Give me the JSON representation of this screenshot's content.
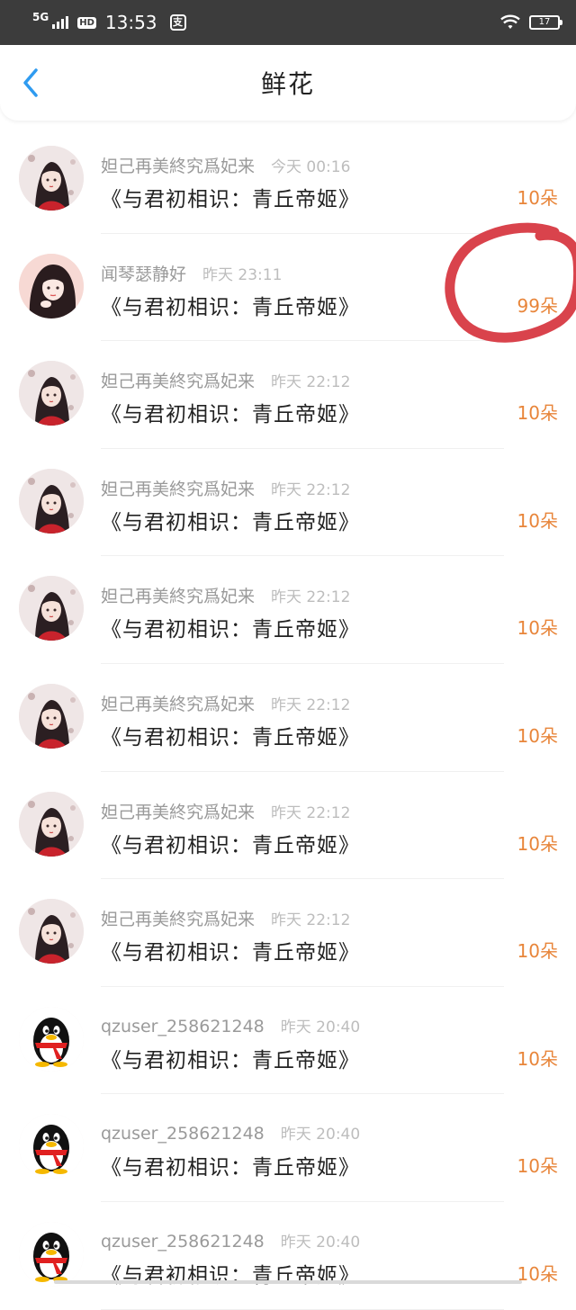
{
  "status": {
    "network": "5G",
    "hd": "HD",
    "time": "13:53",
    "pay_icon": "支",
    "battery": "17"
  },
  "header": {
    "title": "鲜花"
  },
  "rows": [
    {
      "user": "妲己再美終究爲妃来",
      "time": "今天 00:16",
      "book": "《与君初相识：青丘帝姬》",
      "count": "10朵",
      "avatar": "anime-girl"
    },
    {
      "user": "闻琴瑟静好",
      "time": "昨天 23:11",
      "book": "《与君初相识：青丘帝姬》",
      "count": "99朵",
      "avatar": "anime-girl-pink"
    },
    {
      "user": "妲己再美終究爲妃来",
      "time": "昨天 22:12",
      "book": "《与君初相识：青丘帝姬》",
      "count": "10朵",
      "avatar": "anime-girl"
    },
    {
      "user": "妲己再美終究爲妃来",
      "time": "昨天 22:12",
      "book": "《与君初相识：青丘帝姬》",
      "count": "10朵",
      "avatar": "anime-girl"
    },
    {
      "user": "妲己再美終究爲妃来",
      "time": "昨天 22:12",
      "book": "《与君初相识：青丘帝姬》",
      "count": "10朵",
      "avatar": "anime-girl"
    },
    {
      "user": "妲己再美終究爲妃来",
      "time": "昨天 22:12",
      "book": "《与君初相识：青丘帝姬》",
      "count": "10朵",
      "avatar": "anime-girl"
    },
    {
      "user": "妲己再美終究爲妃来",
      "time": "昨天 22:12",
      "book": "《与君初相识：青丘帝姬》",
      "count": "10朵",
      "avatar": "anime-girl"
    },
    {
      "user": "妲己再美終究爲妃来",
      "time": "昨天 22:12",
      "book": "《与君初相识：青丘帝姬》",
      "count": "10朵",
      "avatar": "anime-girl"
    },
    {
      "user": "qzuser_258621248",
      "time": "昨天 20:40",
      "book": "《与君初相识：青丘帝姬》",
      "count": "10朵",
      "avatar": "qq-penguin"
    },
    {
      "user": "qzuser_258621248",
      "time": "昨天 20:40",
      "book": "《与君初相识：青丘帝姬》",
      "count": "10朵",
      "avatar": "qq-penguin"
    },
    {
      "user": "qzuser_258621248",
      "time": "昨天 20:40",
      "book": "《与君初相识：青丘帝姬》",
      "count": "10朵",
      "avatar": "qq-penguin"
    }
  ],
  "colors": {
    "status_bar": "#3c3c3c",
    "back_arrow": "#2f9bf0",
    "count": "#e8853a",
    "annotation": "#d9434c"
  },
  "icons": [
    "back-arrow-icon",
    "wifi-icon",
    "battery-icon",
    "signal-icon"
  ]
}
